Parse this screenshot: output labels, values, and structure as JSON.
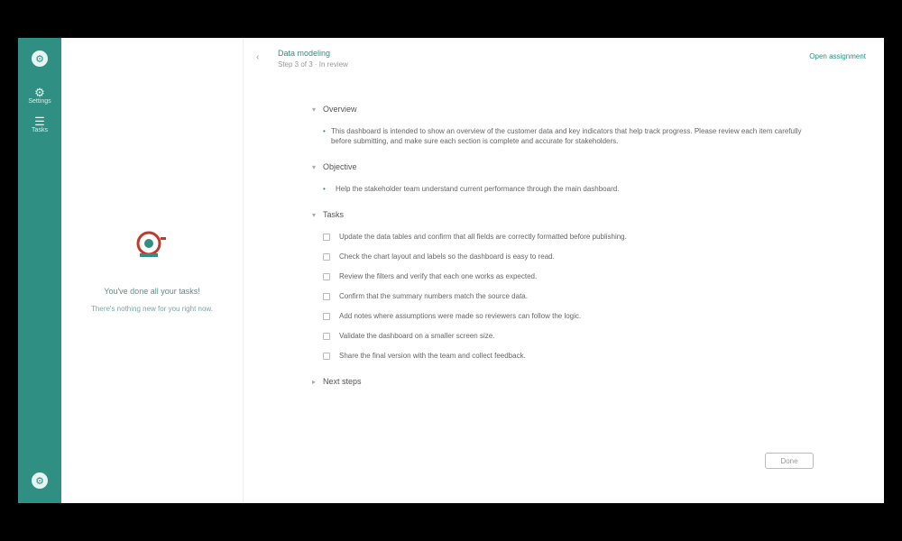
{
  "rail": {
    "logo": "⚙",
    "items": [
      {
        "icon": "⚙",
        "label": "Settings"
      },
      {
        "icon": "☰",
        "label": "Tasks"
      }
    ],
    "bottom_icon": "⚙"
  },
  "left_panel": {
    "empty_title": "You've done all your tasks!",
    "empty_sub": "There's nothing new for you right now."
  },
  "header": {
    "back_icon": "‹",
    "title": "Data modeling",
    "subtitle": "Step 3 of 3 · In review",
    "right_link": "Open assignment"
  },
  "sections": {
    "overview": {
      "label": "Overview",
      "text": "This dashboard is intended to show an overview of the customer data and key indicators that help track progress. Please review each item carefully before submitting, and make sure each section is complete and accurate for stakeholders."
    },
    "objective": {
      "label": "Objective",
      "text": "Help the stakeholder team understand current performance through the main dashboard."
    },
    "tasks": {
      "label": "Tasks",
      "items": [
        "Update the data tables and confirm that all fields are correctly formatted before publishing.",
        "Check the chart layout and labels so the dashboard is easy to read.",
        "Review the filters and verify that each one works as expected.",
        "Confirm that the summary numbers match the source data.",
        "Add notes where assumptions were made so reviewers can follow the logic.",
        "Validate the dashboard on a smaller screen size.",
        "Share the final version with the team and collect feedback."
      ]
    },
    "next_steps": {
      "label": "Next steps"
    }
  },
  "done_button": "Done"
}
